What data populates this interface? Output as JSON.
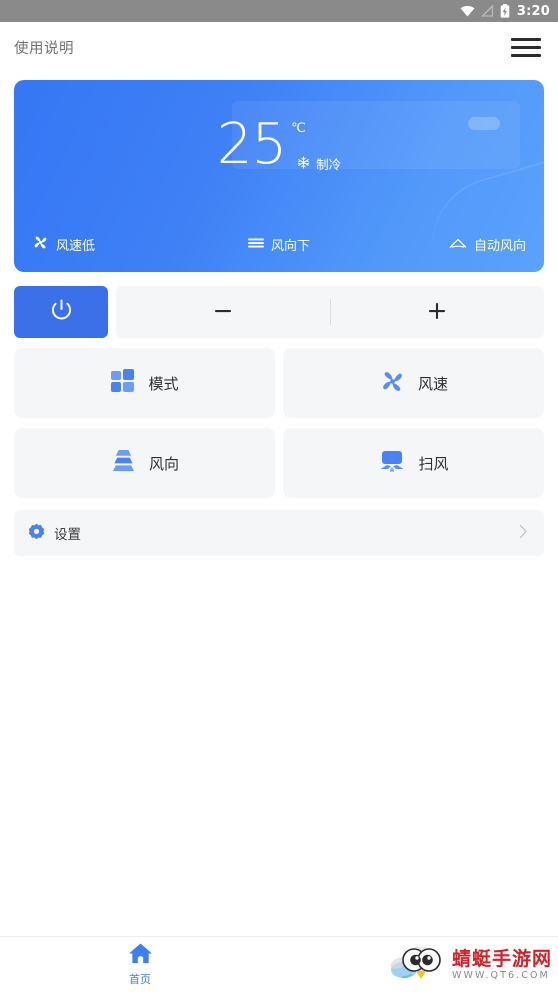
{
  "status_bar": {
    "time": "3:20",
    "icons": [
      "wifi-icon",
      "signal-off-icon",
      "battery-charging-icon"
    ]
  },
  "app_bar": {
    "title": "使用说明",
    "menu_icon": "hamburger-menu-icon"
  },
  "status_card": {
    "temperature": "25",
    "unit": "℃",
    "mode_icon": "snowflake-icon",
    "mode_label": "制冷",
    "bottom_items": [
      {
        "icon": "fan-icon",
        "label": "风速低"
      },
      {
        "icon": "wind-direction-lines-icon",
        "label": "风向下"
      },
      {
        "icon": "auto-wind-arc-icon",
        "label": "自动风向"
      }
    ],
    "gradient_from": "#3577f4",
    "gradient_to": "#5ba2fc"
  },
  "controls": {
    "power": {
      "icon": "power-icon",
      "label": ""
    },
    "decrease": {
      "icon": "minus-icon",
      "label": "−"
    },
    "increase": {
      "icon": "plus-icon",
      "label": "+"
    },
    "accent_color": "#3b70e8"
  },
  "functions": [
    {
      "icon": "grid-squares-icon",
      "label": "模式"
    },
    {
      "icon": "fan-blades-icon",
      "label": "风速"
    },
    {
      "icon": "louver-stack-icon",
      "label": "风向"
    },
    {
      "icon": "ac-unit-swing-icon",
      "label": "扫风"
    }
  ],
  "settings": {
    "icon": "gear-icon",
    "label": "设置",
    "chevron": "chevron-right-icon"
  },
  "bottom_nav": {
    "items": [
      {
        "icon": "home-icon",
        "label": "首页",
        "active": true
      }
    ]
  },
  "watermark": {
    "title": "蜻蜓手游网",
    "url": "WWW.QT6.COM",
    "title_color": "#d2232a"
  }
}
